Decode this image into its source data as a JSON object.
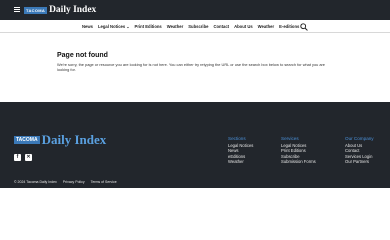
{
  "header": {
    "logo_tag": "TACOMA",
    "logo_text": "Daily Index"
  },
  "nav": {
    "items": [
      {
        "label": "News"
      },
      {
        "label": "Legal Notices"
      },
      {
        "label": "Print Editions"
      },
      {
        "label": "Weather"
      },
      {
        "label": "Subscribe"
      },
      {
        "label": "Contact"
      },
      {
        "label": "About Us"
      },
      {
        "label": "Weather"
      },
      {
        "label": "E-editions"
      }
    ],
    "search_icon": "search-icon"
  },
  "main": {
    "title": "Page not found",
    "body": "We're sorry, the page or resource you are looking for is not here. You can either try retyping the URL or use the search box below to search for what you are looking for."
  },
  "footer": {
    "logo_tag": "TACOMA",
    "logo_text": "Daily Index",
    "social": [
      "facebook-icon",
      "x-icon"
    ],
    "columns": [
      {
        "heading": "Sections",
        "links": [
          "Legal Notices",
          "News",
          "eEditions",
          "Weather"
        ]
      },
      {
        "heading": "Services",
        "links": [
          "Legal Notices",
          "Print Editions",
          "Subscribe",
          "Submission Forms"
        ]
      },
      {
        "heading": "Our Company",
        "links": [
          "About Us",
          "Contact",
          "Services Login",
          "Our Partners"
        ]
      }
    ],
    "bottom": {
      "copyright": "© 2024 Tacoma Daily Index",
      "privacy": "Privacy Policy",
      "terms": "Terms of Service"
    }
  },
  "colors": {
    "dark_bg": "#22262c",
    "accent_blue": "#4a90d9",
    "logo_blue": "#3b79b8"
  }
}
